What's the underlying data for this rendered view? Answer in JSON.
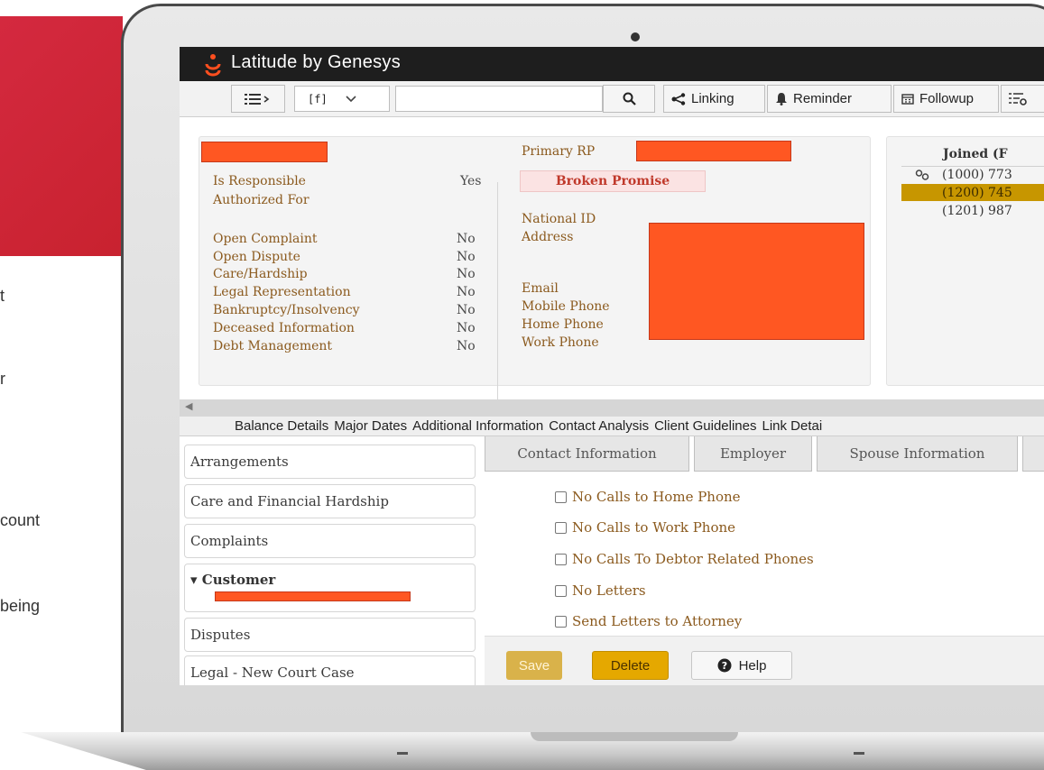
{
  "background_fragments": [
    "t",
    "r",
    "count",
    "being"
  ],
  "app": {
    "title": "Latitude by Genesys"
  },
  "toolbar": {
    "field_code": "[f]",
    "search_value": "",
    "linking_label": "Linking",
    "reminder_label": "Reminder",
    "followup_label": "Followup"
  },
  "left_summary": {
    "items": [
      {
        "label": "Is Responsible",
        "value": "Yes"
      },
      {
        "label": "Authorized For",
        "value": ""
      },
      {
        "label": "Open Complaint",
        "value": "No"
      },
      {
        "label": "Open Dispute",
        "value": "No"
      },
      {
        "label": "Care/Hardship",
        "value": "No"
      },
      {
        "label": "Legal Representation",
        "value": "No"
      },
      {
        "label": "Bankruptcy/Insolvency",
        "value": "No"
      },
      {
        "label": "Deceased Information",
        "value": "No"
      },
      {
        "label": "Debt Management",
        "value": "No"
      }
    ]
  },
  "middle_summary": {
    "primary_rp_label": "Primary RP",
    "status_badge": "Broken Promise",
    "national_id_label": "National ID",
    "address_label": "Address",
    "email_label": "Email",
    "mobile_phone_label": "Mobile Phone",
    "home_phone_label": "Home Phone",
    "work_phone_label": "Work Phone"
  },
  "joined_panel": {
    "header": "Joined (F",
    "rows": [
      "(1000) 773",
      "(1200) 745",
      "(1201) 987"
    ]
  },
  "nav_tabs": [
    "Balance Details",
    "Major Dates",
    "Additional Information",
    "Contact Analysis",
    "Client Guidelines",
    "Link Detai"
  ],
  "sidebar": {
    "items": [
      {
        "label": "Arrangements"
      },
      {
        "label": "Care and Financial Hardship"
      },
      {
        "label": "Complaints"
      },
      {
        "label": "Customer"
      },
      {
        "label": "Disputes"
      },
      {
        "label": "Legal - New Court Case"
      }
    ]
  },
  "sub_tabs": [
    "Contact Information",
    "Employer",
    "Spouse Information"
  ],
  "options": [
    {
      "label": "No Calls to Home Phone",
      "checked": false
    },
    {
      "label": "No Calls to Work Phone",
      "checked": false
    },
    {
      "label": "No Calls To Debtor Related Phones",
      "checked": false
    },
    {
      "label": "No Letters",
      "checked": false
    },
    {
      "label": "Send Letters to Attorney",
      "checked": false
    }
  ],
  "actions": {
    "save_label": "Save",
    "delete_label": "Delete",
    "help_label": "Help"
  },
  "colors": {
    "accent_red": "#d4293f",
    "redaction": "#ff5722",
    "label_brown": "#8b5a1e",
    "save_button": "#d9b24a",
    "delete_button": "#e5a800",
    "selected_row": "#c79600"
  }
}
